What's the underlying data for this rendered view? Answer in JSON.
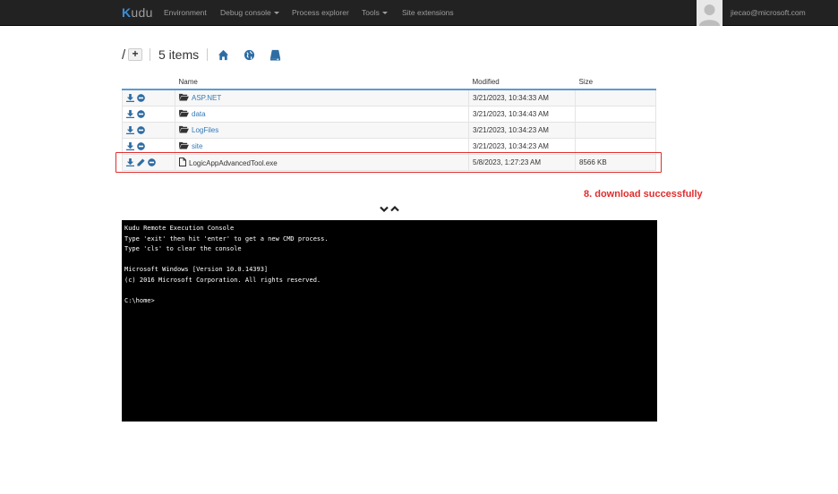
{
  "navbar": {
    "brand_k": "K",
    "brand_rest": "udu",
    "items": [
      "Environment",
      "Debug console",
      "Process explorer",
      "Tools",
      "Site extensions"
    ],
    "user_email": "jiecao@microsoft.com"
  },
  "toolbar": {
    "root": "/",
    "add_label": "+",
    "items_count": "5 items"
  },
  "table": {
    "headers": [
      "Name",
      "Modified",
      "Size"
    ],
    "rows": [
      {
        "name": "ASP.NET",
        "modified": "3/21/2023, 10:34:33 AM",
        "size": ""
      },
      {
        "name": "data",
        "modified": "3/21/2023, 10:34:43 AM",
        "size": ""
      },
      {
        "name": "LogFiles",
        "modified": "3/21/2023, 10:34:23 AM",
        "size": ""
      },
      {
        "name": "site",
        "modified": "3/21/2023, 10:34:23 AM",
        "size": ""
      },
      {
        "name": "LogicAppAdvancedTool.exe",
        "modified": "5/8/2023, 1:27:23 AM",
        "size": "8566 KB"
      }
    ]
  },
  "annotation": "8. download successfully",
  "console": {
    "lines": [
      "Kudu Remote Execution Console",
      "Type 'exit' then hit 'enter' to get a new CMD process.",
      "Type 'cls' to clear the console",
      "",
      "Microsoft Windows [Version 10.0.14393]",
      "(c) 2016 Microsoft Corporation. All rights reserved.",
      "",
      "C:\\home>"
    ]
  },
  "colors": {
    "navbar_bg": "#222222",
    "link": "#337ab7",
    "icon_blue": "#2e6da4",
    "annotation_red": "#e02d2d"
  }
}
